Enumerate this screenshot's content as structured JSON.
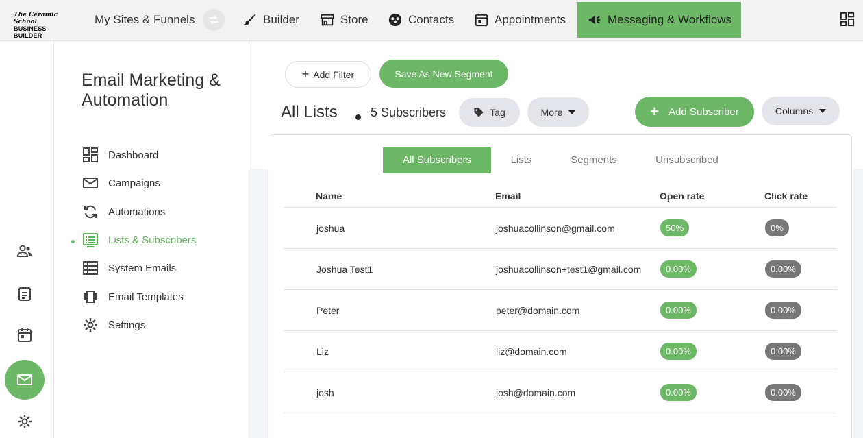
{
  "brand": {
    "logo_line1": "The Ceramic School",
    "logo_line2": "BUSINESS BUILDER"
  },
  "topnav": {
    "sites": "My Sites & Funnels",
    "builder": "Builder",
    "store": "Store",
    "contacts": "Contacts",
    "appointments": "Appointments",
    "messaging": "Messaging & Workflows"
  },
  "sidebar": {
    "title": "Email Marketing & Automation",
    "items": [
      {
        "label": "Dashboard",
        "icon": "dashboard-icon"
      },
      {
        "label": "Campaigns",
        "icon": "envelope-icon"
      },
      {
        "label": "Automations",
        "icon": "sync-icon"
      },
      {
        "label": "Lists & Subscribers",
        "icon": "list-icon",
        "active": true
      },
      {
        "label": "System Emails",
        "icon": "table-list-icon"
      },
      {
        "label": "Email Templates",
        "icon": "carousel-icon"
      },
      {
        "label": "Settings",
        "icon": "gear-icon"
      }
    ]
  },
  "toolbar": {
    "add_filter": "Add Filter",
    "save_segment": "Save As New Segment",
    "title": "All Lists",
    "subscriber_count": "5 Subscribers",
    "tag": "Tag",
    "more": "More",
    "add_subscriber": "Add Subscriber",
    "columns": "Columns"
  },
  "tabs": [
    "All Subscribers",
    "Lists",
    "Segments",
    "Unsubscribed"
  ],
  "table": {
    "headers": [
      "Name",
      "Email",
      "Open rate",
      "Click rate"
    ],
    "rows": [
      {
        "name": "joshua",
        "email": "joshuacollinson@gmail.com",
        "open": "50%",
        "click": "0%"
      },
      {
        "name": "Joshua Test1",
        "email": "joshuacollinson+test1@gmail.com",
        "open": "0.00%",
        "click": "0.00%"
      },
      {
        "name": "Peter",
        "email": "peter@domain.com",
        "open": "0.00%",
        "click": "0.00%"
      },
      {
        "name": "Liz",
        "email": "liz@domain.com",
        "open": "0.00%",
        "click": "0.00%"
      },
      {
        "name": "josh",
        "email": "josh@domain.com",
        "open": "0.00%",
        "click": "0.00%"
      }
    ]
  },
  "colors": {
    "accent": "#6db866",
    "badge_grey": "#787878",
    "topbar": "#f2f2f2"
  }
}
